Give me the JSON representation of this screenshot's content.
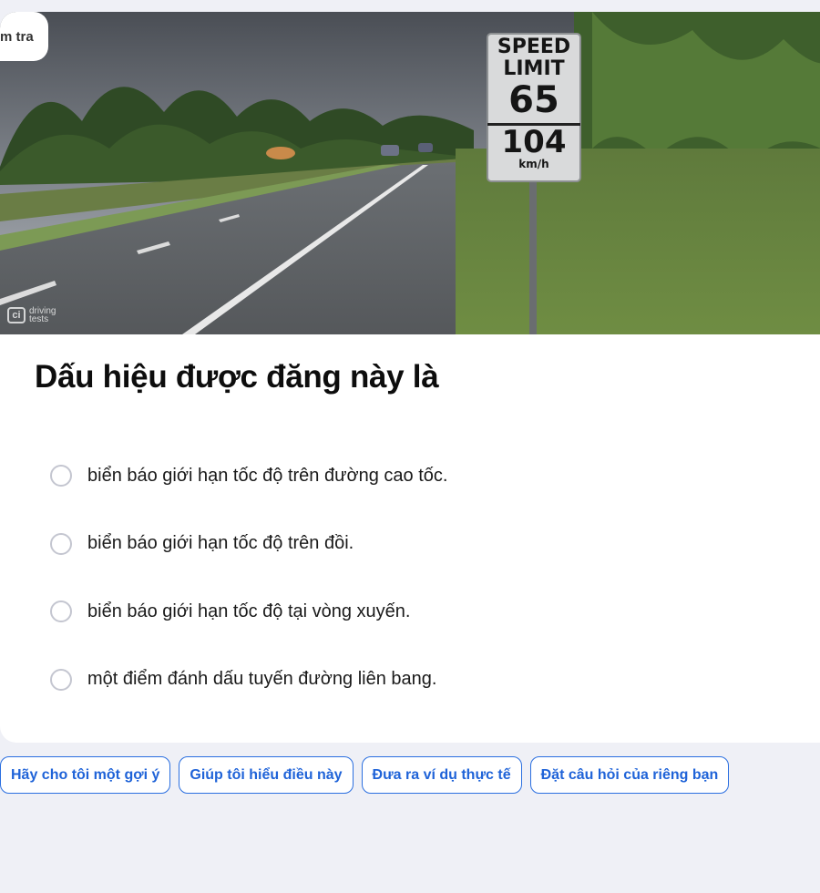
{
  "header": {
    "tab_label": "m tra"
  },
  "hero_image": {
    "watermark_line1": "driving",
    "watermark_line2": "tests",
    "sign": {
      "line1": "SPEED",
      "line2": "LIMIT",
      "mph": "65",
      "kmh": "104",
      "unit": "km/h"
    }
  },
  "question": {
    "text": "Dấu hiệu được đăng này là",
    "options": [
      {
        "label": "biển báo giới hạn tốc độ trên đường cao tốc.",
        "selected": false
      },
      {
        "label": "biển báo giới hạn tốc độ trên đồi.",
        "selected": false
      },
      {
        "label": "biển báo giới hạn tốc độ tại vòng xuyến.",
        "selected": false
      },
      {
        "label": "một điểm đánh dấu tuyến đường liên bang.",
        "selected": false
      }
    ]
  },
  "suggestions": [
    {
      "label": "Hãy cho tôi một gợi ý"
    },
    {
      "label": "Giúp tôi hiểu điều này"
    },
    {
      "label": "Đưa ra ví dụ thực tế"
    },
    {
      "label": "Đặt câu hỏi của riêng bạn"
    }
  ],
  "colors": {
    "page_bg": "#eff0f6",
    "card_bg": "#ffffff",
    "accent": "#1f63d8",
    "radio_border": "#c4c6d0"
  }
}
